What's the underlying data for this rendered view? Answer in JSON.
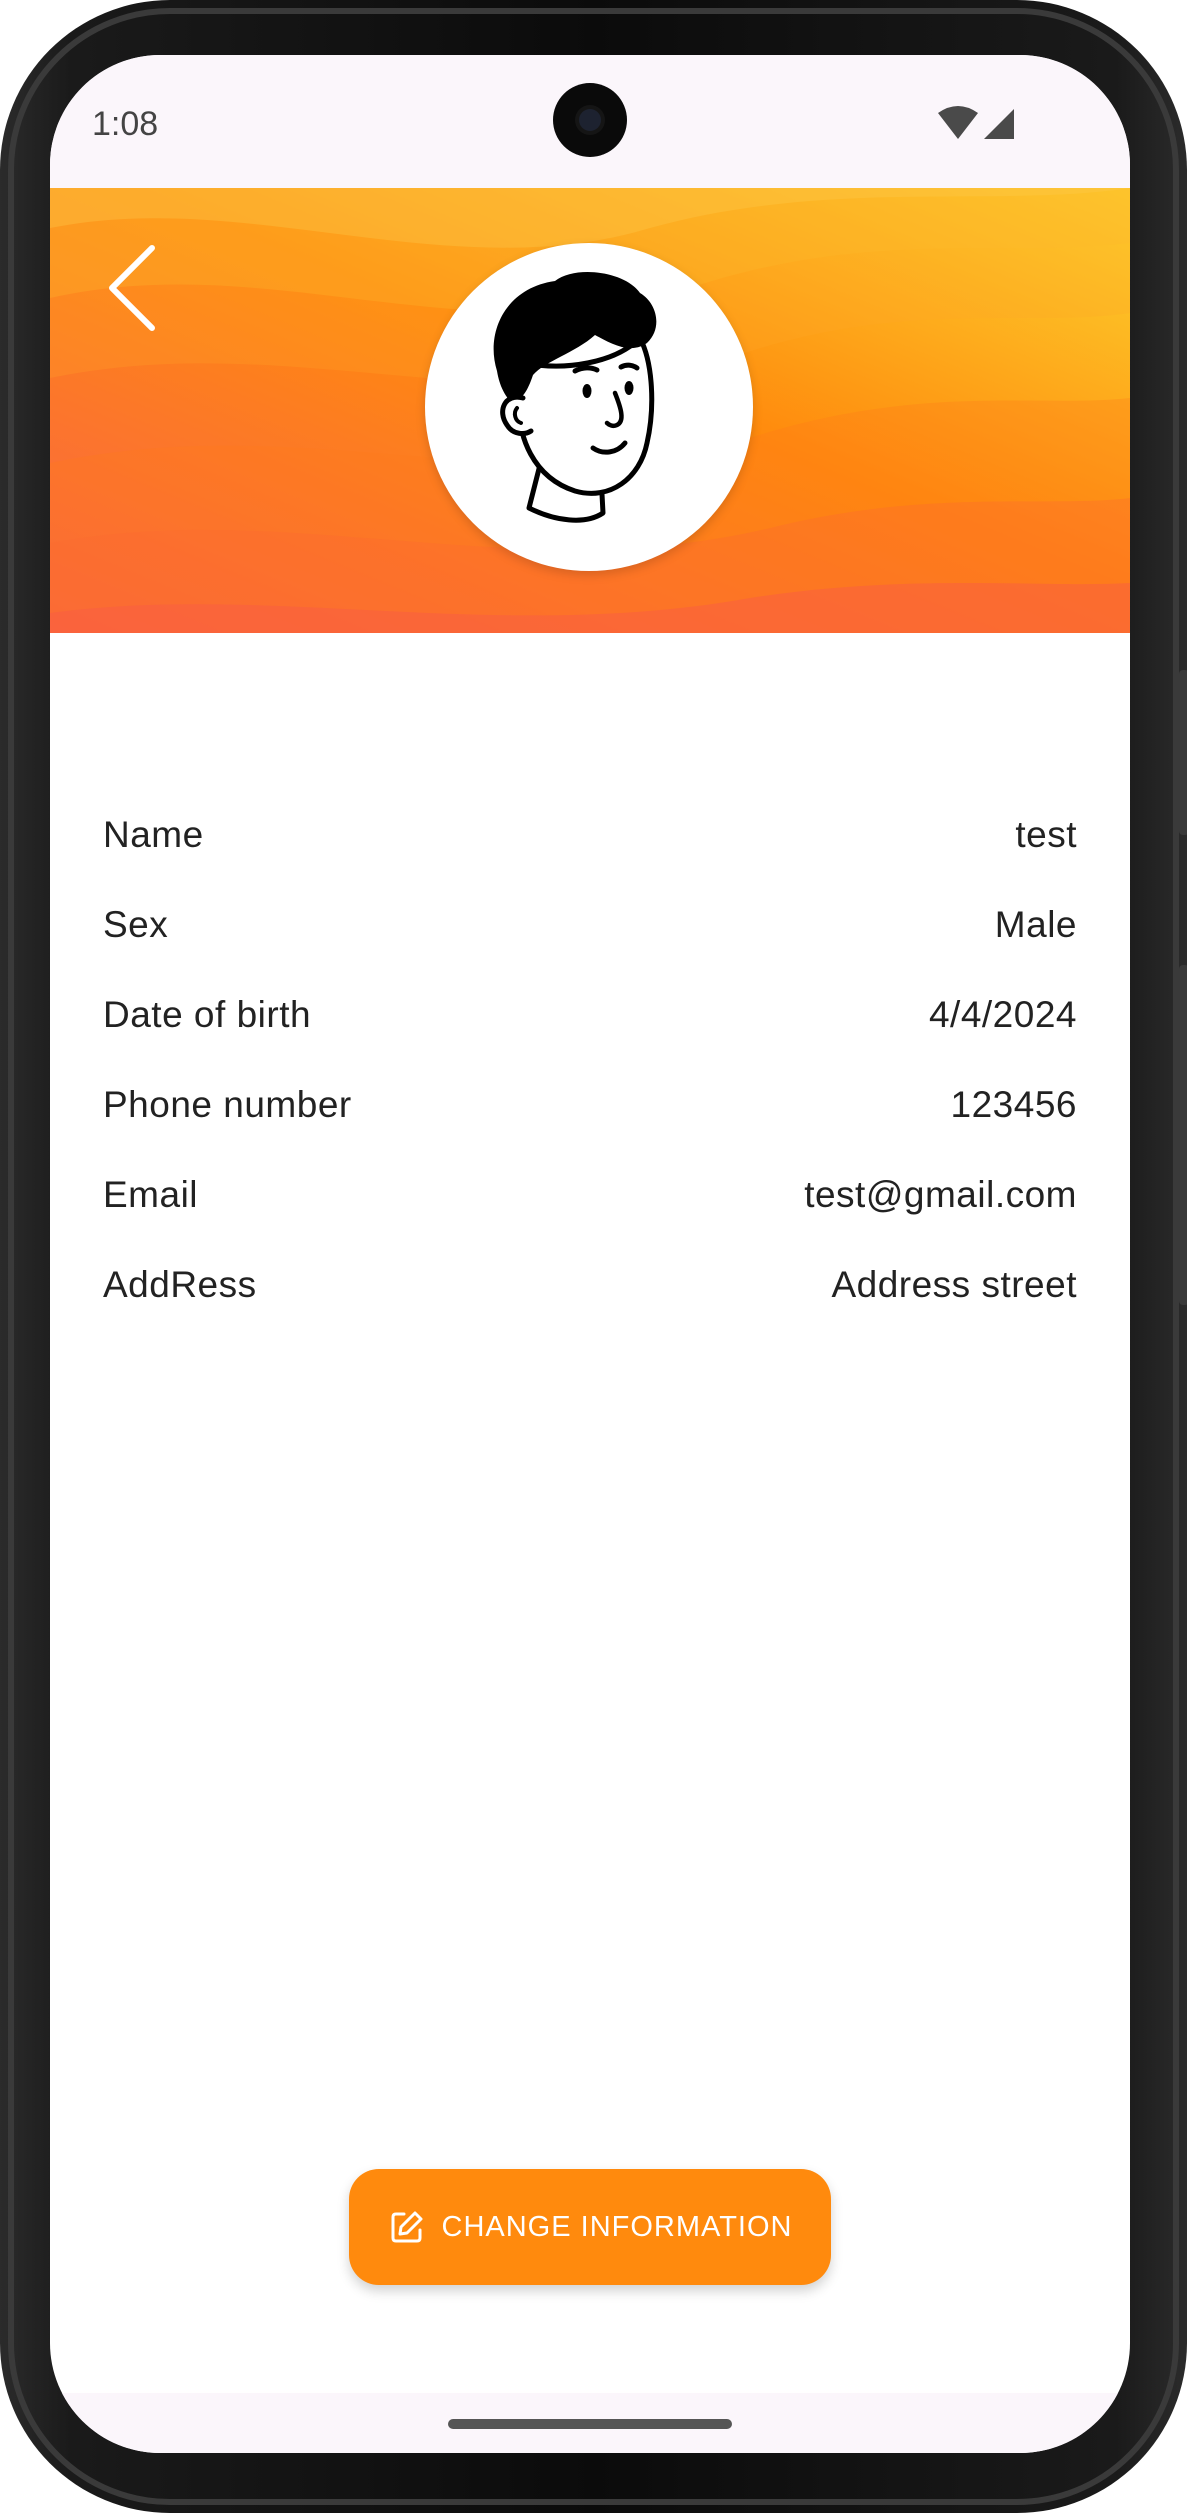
{
  "status_bar": {
    "time": "1:08",
    "icons": [
      "wifi-icon",
      "cellular-signal-icon"
    ]
  },
  "header": {
    "back_icon": "chevron-left-icon",
    "avatar": "cartoon-face-avatar",
    "colors": {
      "gradient_top": "#fcd32e",
      "gradient_mid": "#ff8a0d",
      "gradient_bottom": "#f96446"
    }
  },
  "profile": {
    "fields": [
      {
        "label": "Name",
        "value": "test"
      },
      {
        "label": "Sex",
        "value": "Male"
      },
      {
        "label": "Date of birth",
        "value": "4/4/2024"
      },
      {
        "label": "Phone number",
        "value": "123456"
      },
      {
        "label": "Email",
        "value": "test@gmail.com"
      },
      {
        "label": "AddRess",
        "value": "Address street"
      }
    ]
  },
  "actions": {
    "change_label": "CHANGE INFORMATION",
    "change_icon": "edit-icon",
    "accent_color": "#ff8a0d"
  }
}
